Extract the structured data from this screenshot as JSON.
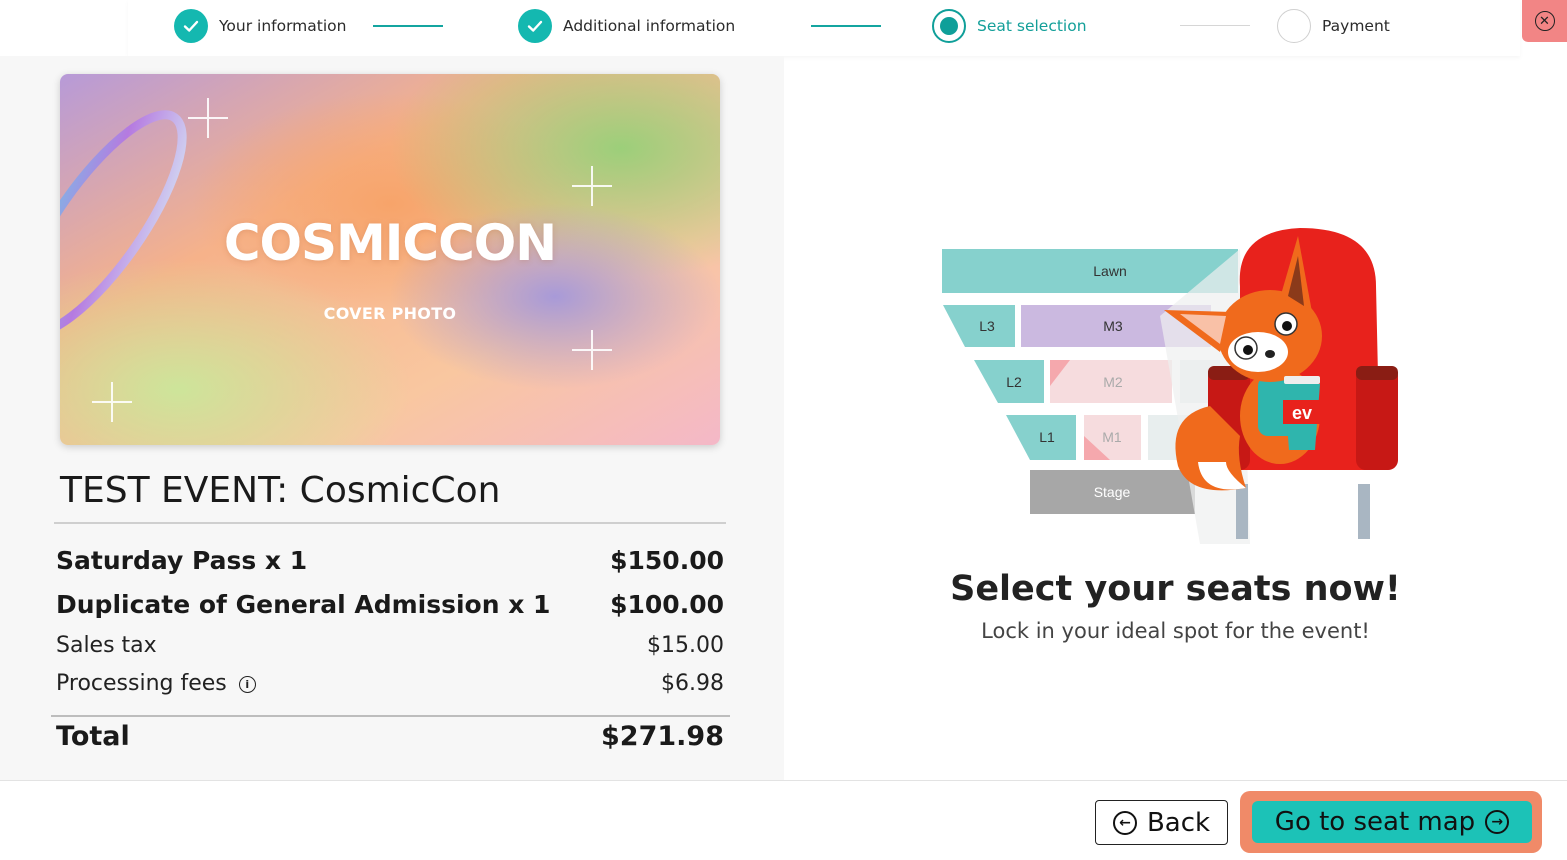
{
  "stepper": {
    "steps": [
      {
        "label": "Your information",
        "state": "done"
      },
      {
        "label": "Additional information",
        "state": "done"
      },
      {
        "label": "Seat selection",
        "state": "active"
      },
      {
        "label": "Payment",
        "state": "todo"
      }
    ]
  },
  "close": {
    "icon": "close-circle-icon"
  },
  "event": {
    "cover_title": "COSMICCON",
    "cover_subtitle": "COVER PHOTO",
    "title": "TEST EVENT: CosmicCon"
  },
  "order": {
    "items": [
      {
        "label": "Saturday Pass x 1",
        "amount": "$150.00"
      },
      {
        "label": "Duplicate of General Admission x 1",
        "amount": "$100.00"
      }
    ],
    "sales_tax_label": "Sales tax",
    "sales_tax": "$15.00",
    "fees_label": "Processing fees",
    "fees": "$6.98",
    "total_label": "Total",
    "total": "$271.98"
  },
  "seatmap_illustration": {
    "sections": [
      "Lawn",
      "L3",
      "M3",
      "L2",
      "M2",
      "L1",
      "M1",
      "Stage"
    ],
    "mascot_cup_text": "ev"
  },
  "promo": {
    "headline": "Select your seats now!",
    "subline": "Lock in your ideal spot for the event!"
  },
  "footer": {
    "back_label": "Back",
    "go_label": "Go to seat map"
  },
  "colors": {
    "accent": "#14b8b0",
    "cta": "#1cc2b7",
    "cta_ring": "#f08a68",
    "close_bg": "#f28585"
  }
}
